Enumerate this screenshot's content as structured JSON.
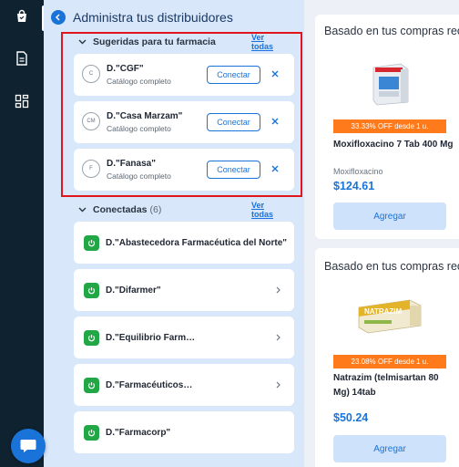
{
  "rail": {
    "icons": [
      "bag-icon",
      "document-icon",
      "grid-icon"
    ]
  },
  "panel": {
    "title": "Administra tus distribuidores",
    "suggested": {
      "title": "Sugeridas para tu farmacia",
      "see_all": "Ver todas",
      "items": [
        {
          "initials": "C",
          "name": "D.\"CGF\"",
          "subtitle": "Catálogo completo",
          "button": "Conectar"
        },
        {
          "initials": "CM",
          "name": "D.\"Casa Marzam\"",
          "subtitle": "Catálogo completo",
          "button": "Conectar"
        },
        {
          "initials": "F",
          "name": "D.\"Fanasa\"",
          "subtitle": "Catálogo completo",
          "button": "Conectar"
        }
      ]
    },
    "connected": {
      "title": "Conectadas",
      "count": "(6)",
      "see_all": "Ver todas",
      "items": [
        {
          "name": "D.\"Abastecedora Farmacéutica del Norte\""
        },
        {
          "name": "D.\"Difarmer\""
        },
        {
          "name": "D.\"Equilibrio Farmacéutico\""
        },
        {
          "name": "D.\"Farmacéuticos Tenorio\""
        },
        {
          "name": "D.\"Farmacorp\""
        }
      ]
    }
  },
  "recommendations": [
    {
      "title": "Basado en tus compras reci",
      "offer": "33.33% OFF desde 1 u.",
      "product": "Moxifloxacino 7 Tab 400 Mg",
      "substance": "Moxifloxacino",
      "price": "$124.61",
      "button": "Agregar"
    },
    {
      "title": "Basado en tus compras reci",
      "offer": "23.08% OFF desde 1 u.",
      "product": "Natrazim (telmisartan 80 Mg) 14tab",
      "price": "$50.24",
      "button": "Agregar",
      "box_label": "NATRAZIM"
    }
  ],
  "colors": {
    "accent": "#1a73d9",
    "connected_green": "#22a746",
    "offer_orange": "#ff7a1a",
    "highlight_red": "#e0161c"
  }
}
